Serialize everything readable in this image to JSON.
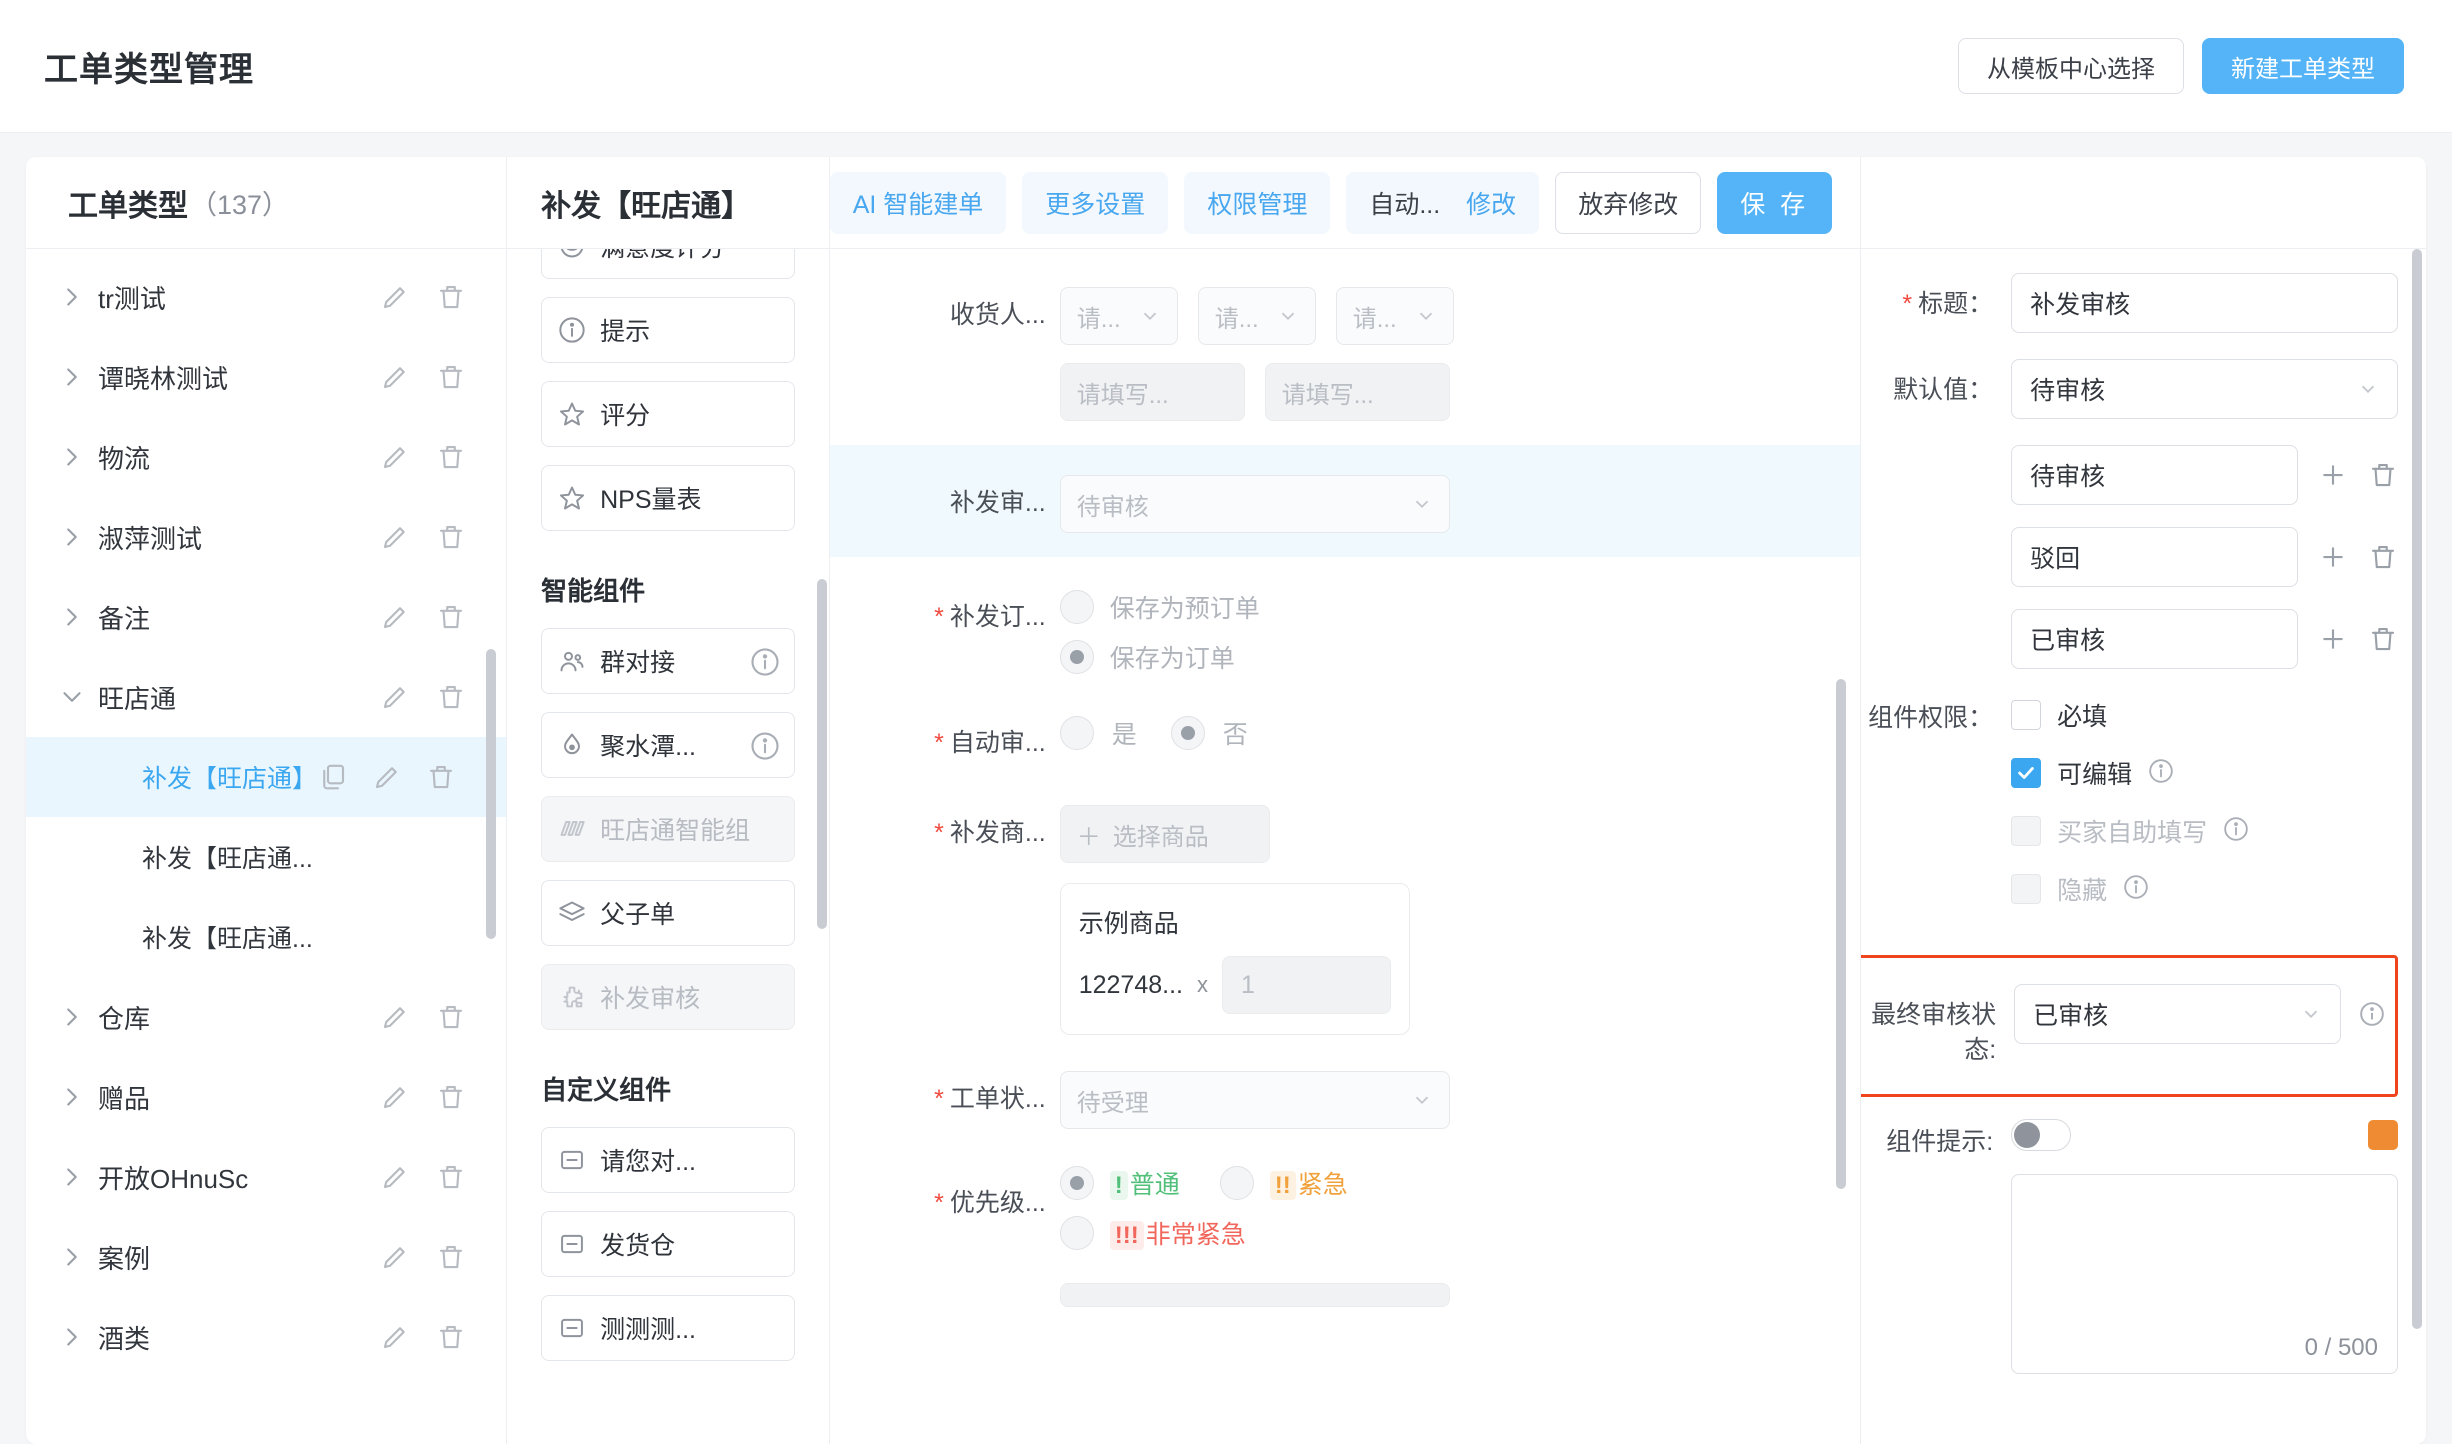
{
  "header": {
    "title": "工单类型管理",
    "buttons": [
      {
        "label": "从模板中心选择",
        "style": "outline",
        "name": "select-from-template-center-button"
      },
      {
        "label": "新建工单类型",
        "style": "primary",
        "name": "new-ticket-type-button"
      }
    ]
  },
  "type_list": {
    "title": "工单类型",
    "count": "（137）",
    "items": [
      {
        "label": "tr测试",
        "level": 0,
        "expanded": false,
        "active": false
      },
      {
        "label": "谭晓林测试",
        "level": 0,
        "expanded": false,
        "active": false
      },
      {
        "label": "物流",
        "level": 0,
        "expanded": false,
        "active": false
      },
      {
        "label": "淑萍测试",
        "level": 0,
        "expanded": false,
        "active": false
      },
      {
        "label": "备注",
        "level": 0,
        "expanded": false,
        "active": false
      },
      {
        "label": "旺店通",
        "level": 0,
        "expanded": true,
        "active": false
      },
      {
        "label": "补发【旺店通】",
        "level": 1,
        "expanded": false,
        "active": true
      },
      {
        "label": "补发【旺店通...",
        "level": 1,
        "expanded": false,
        "active": false
      },
      {
        "label": "补发【旺店通...",
        "level": 1,
        "expanded": false,
        "active": false
      },
      {
        "label": "仓库",
        "level": 0,
        "expanded": false,
        "active": false
      },
      {
        "label": "赠品",
        "level": 0,
        "expanded": false,
        "active": false
      },
      {
        "label": "开放OHnuSc",
        "level": 0,
        "expanded": false,
        "active": false
      },
      {
        "label": "案例",
        "level": 0,
        "expanded": false,
        "active": false
      },
      {
        "label": "酒类",
        "level": 0,
        "expanded": false,
        "active": false
      }
    ]
  },
  "palette": {
    "title": "补发【旺店通】",
    "basic_items": [
      {
        "label": "满意度评分",
        "icon": "smile-icon",
        "disabled": false,
        "info": false,
        "clipped": true
      },
      {
        "label": "提示",
        "icon": "info-circle-icon",
        "disabled": false,
        "info": false
      },
      {
        "label": "评分",
        "icon": "star-icon",
        "disabled": false,
        "info": false
      },
      {
        "label": "NPS量表",
        "icon": "star-icon",
        "disabled": false,
        "info": false
      }
    ],
    "smart_title": "智能组件",
    "smart_items": [
      {
        "label": "群对接",
        "icon": "group-icon",
        "disabled": false,
        "info": true
      },
      {
        "label": "聚水潭...",
        "icon": "drop-icon",
        "disabled": false,
        "info": true
      },
      {
        "label": "旺店通智能组",
        "icon": "module-icon",
        "disabled": true,
        "info": false
      },
      {
        "label": "父子单",
        "icon": "layers-icon",
        "disabled": false,
        "info": false
      },
      {
        "label": "补发审核",
        "icon": "puzzle-icon",
        "disabled": true,
        "info": false
      }
    ],
    "custom_title": "自定义组件",
    "custom_items": [
      {
        "label": "请您对...",
        "icon": "minus-box-icon",
        "disabled": false,
        "info": false
      },
      {
        "label": "发货仓",
        "icon": "minus-box-icon",
        "disabled": false,
        "info": false
      },
      {
        "label": "测测测...",
        "icon": "minus-box-icon",
        "disabled": false,
        "info": false
      }
    ]
  },
  "canvas_toolbar": [
    {
      "label": "AI 智能建单",
      "style": "light",
      "name": "ai-smart-create-button"
    },
    {
      "label": "更多设置",
      "style": "light",
      "name": "more-settings-button"
    },
    {
      "label": "权限管理",
      "style": "light",
      "name": "permission-management-button"
    },
    {
      "label": "自动...",
      "label2": "修改",
      "style": "auto",
      "name": "auto-modify-button"
    },
    {
      "label": "放弃修改",
      "style": "outline",
      "name": "discard-changes-button"
    },
    {
      "label": "保 存",
      "style": "save",
      "name": "save-button"
    }
  ],
  "form": {
    "receiver": {
      "label": "收货人...",
      "selects": [
        "请...",
        "请...",
        "请..."
      ],
      "inputs": [
        "请填写...",
        "请填写..."
      ]
    },
    "audit": {
      "label": "补发审...",
      "value": "待审核"
    },
    "order_type": {
      "label": "补发订...",
      "required": true,
      "options": [
        {
          "label": "保存为预订单",
          "checked": false
        },
        {
          "label": "保存为订单",
          "checked": true
        }
      ]
    },
    "auto_audit": {
      "label": "自动审...",
      "required": true,
      "options": [
        {
          "label": "是",
          "checked": false
        },
        {
          "label": "否",
          "checked": true
        }
      ]
    },
    "product": {
      "label": "补发商...",
      "required": true,
      "select_button": "选择商品",
      "name": "示例商品",
      "sku": "122748...",
      "multiply": "x",
      "qty": "1"
    },
    "ticket_status": {
      "label": "工单状...",
      "required": true,
      "value": "待受理"
    },
    "priority": {
      "label": "优先级...",
      "required": true,
      "options": [
        {
          "badge": "!",
          "label": "普通",
          "checked": true,
          "tone": "normal"
        },
        {
          "badge": "!!",
          "label": "紧急",
          "checked": false,
          "tone": "urgent"
        },
        {
          "badge": "!!!",
          "label": "非常紧急",
          "checked": false,
          "tone": "critical"
        }
      ]
    }
  },
  "properties": {
    "title_field": {
      "label": "标题：",
      "required": true,
      "value": "补发审核"
    },
    "default_field": {
      "label": "默认值：",
      "value": "待审核"
    },
    "options": [
      {
        "value": "待审核"
      },
      {
        "value": "驳回"
      },
      {
        "value": "已审核"
      }
    ],
    "permission": {
      "label": "组件权限：",
      "checkboxes": [
        {
          "label": "必填",
          "checked": false,
          "disabled": false,
          "info": false
        },
        {
          "label": "可编辑",
          "checked": true,
          "disabled": false,
          "info": true
        },
        {
          "label": "买家自助填写",
          "checked": false,
          "disabled": true,
          "info": true
        },
        {
          "label": "隐藏",
          "checked": false,
          "disabled": true,
          "info": true
        }
      ]
    },
    "final_status": {
      "label": "最终审核状态:",
      "value": "已审核",
      "highlighted": true,
      "highlight_color": "#f0441f"
    },
    "component_tip": {
      "label": "组件提示:",
      "toggle_on": false,
      "swatch_color": "#ef8b32",
      "textarea_value": "",
      "counter": "0 / 500"
    }
  },
  "colors": {
    "accent": "#55b4f7",
    "link": "#48a7ef",
    "danger": "#f04a3f",
    "highlight": "#f0441f",
    "selected_row_bg": "#eaf6fe"
  }
}
